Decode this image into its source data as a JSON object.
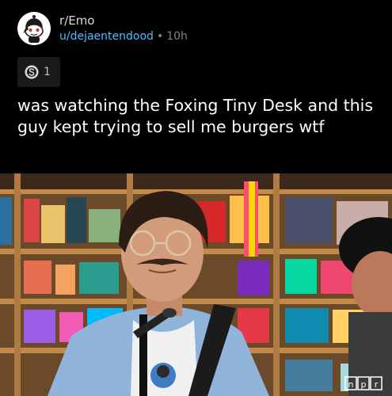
{
  "post": {
    "subreddit": "r/Emo",
    "author": "u/dejaentendood",
    "separator": "•",
    "age": "10h",
    "award": {
      "icon": "silver-award-icon",
      "count": "1"
    },
    "title": "was watching the Foxing Tiny Desk and this guy kept trying to sell me burgers wtf",
    "image": {
      "subject": "man-with-glasses-and-mustache-at-microphone",
      "watermark": "npr"
    }
  },
  "colors": {
    "background": "#000000",
    "author_link": "#4fbcff",
    "meta_text": "#818384",
    "title_text": "#ffffff",
    "award_chip": "#1a1a1b"
  }
}
